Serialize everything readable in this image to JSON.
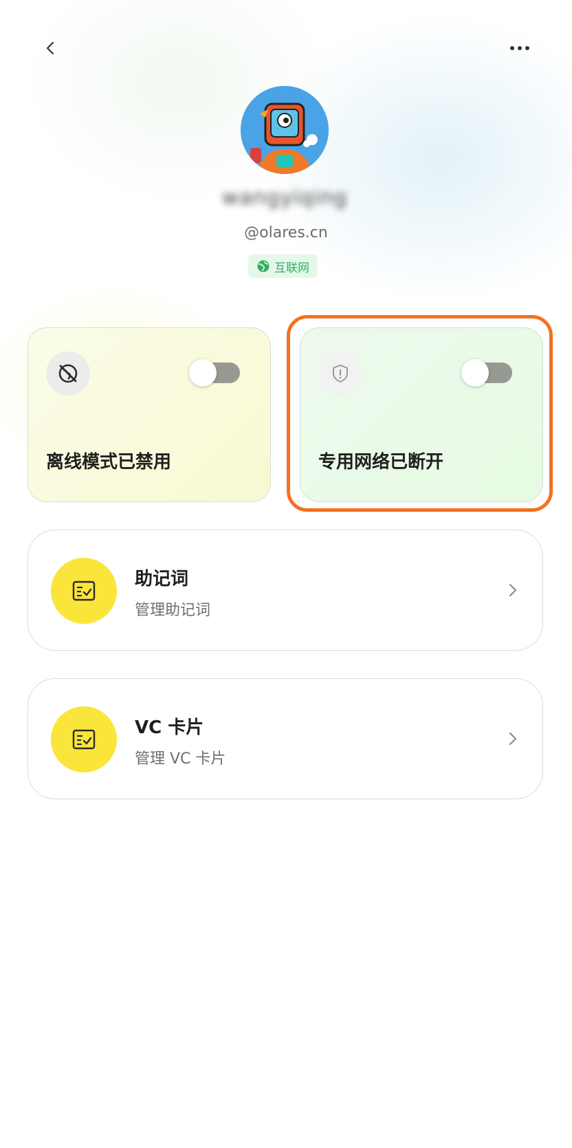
{
  "header": {
    "back_icon": "chevron-left-icon",
    "more_icon": "more-horizontal-icon"
  },
  "profile": {
    "username": "wangyiqing",
    "domain": "@olares.cn",
    "network_badge": "互联网",
    "network_badge_color": "#2fb160"
  },
  "tiles": {
    "offline": {
      "label": "离线模式已禁用",
      "icon": "offline-globe-icon",
      "enabled": false
    },
    "vpn": {
      "label": "专用网络已断开",
      "icon": "shield-alert-icon",
      "enabled": false
    }
  },
  "rows": [
    {
      "title": "助记词",
      "subtitle": "管理助记词",
      "icon": "checklist-icon"
    },
    {
      "title": "VC 卡片",
      "subtitle": "管理 VC 卡片",
      "icon": "checklist-icon"
    }
  ],
  "colors": {
    "accent_highlight": "#f5701e",
    "icon_yellow": "#fae53a"
  }
}
